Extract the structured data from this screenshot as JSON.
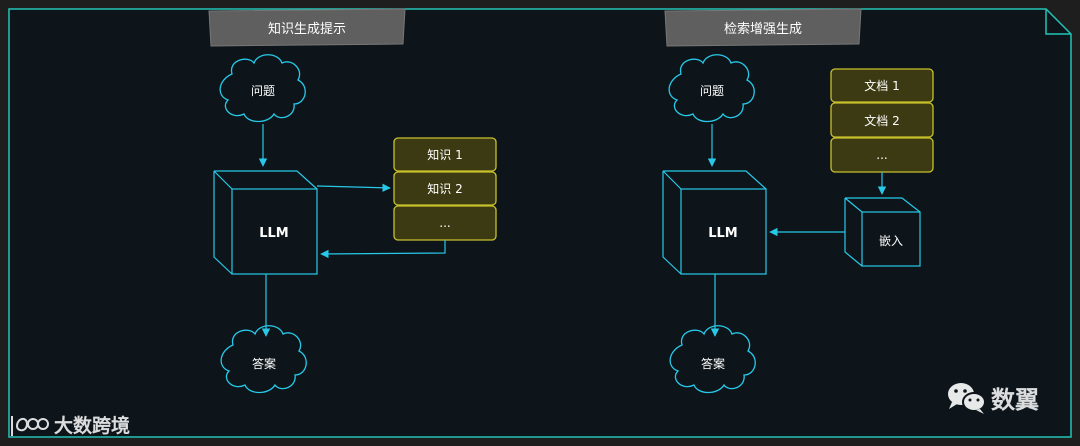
{
  "colors": {
    "frame_bg": "#0d151b",
    "frame_border": "#23c4b6",
    "accent": "#27c9e8",
    "banner_fill": "#5f5f5f",
    "box_fill": "#3c3a12",
    "box_border": "#c9c12c",
    "text": "#ffffff"
  },
  "left": {
    "title": "知识生成提示",
    "question": "问题",
    "llm": "LLM",
    "answer": "答案",
    "items": [
      "知识 1",
      "知识 2",
      "..."
    ]
  },
  "right": {
    "title": "检索增强生成",
    "question": "问题",
    "llm": "LLM",
    "answer": "答案",
    "docs": [
      "文档 1",
      "文档 2",
      "..."
    ],
    "embed": "嵌入"
  },
  "watermarks": {
    "left_logo_text": "大数跨境",
    "right_brand": "数翼"
  }
}
